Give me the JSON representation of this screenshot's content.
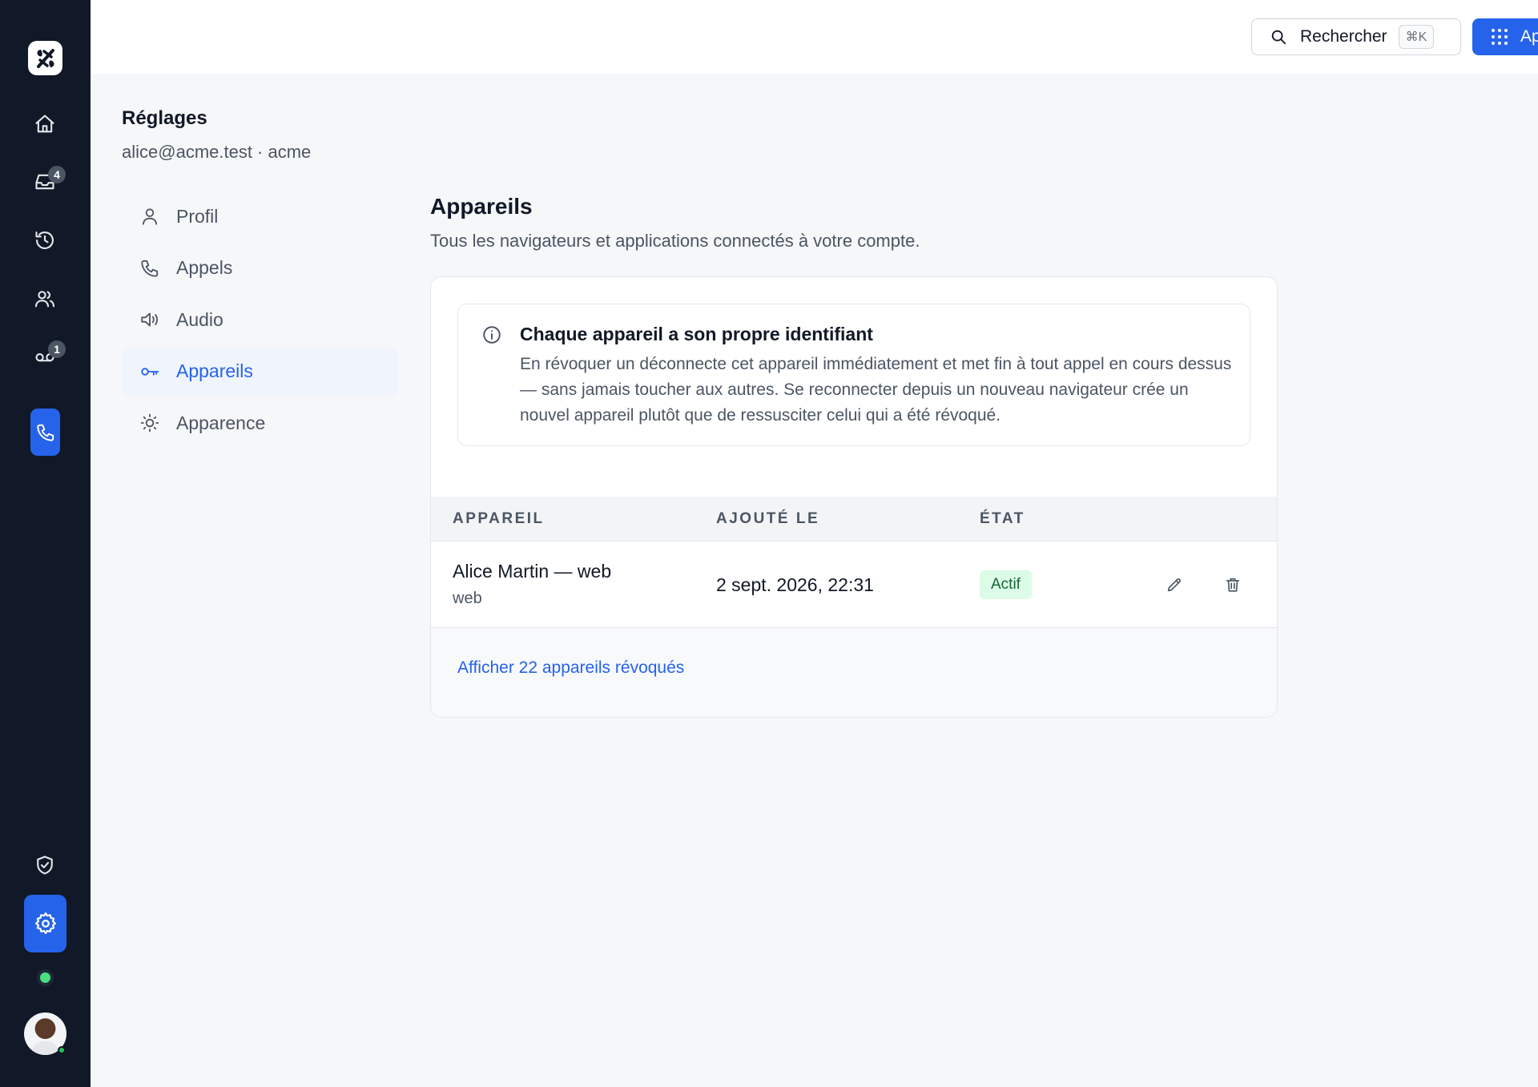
{
  "rail": {
    "logo_icon": "app-logo-icon",
    "items": [
      {
        "name": "home",
        "icon": "home-icon"
      },
      {
        "name": "inbox",
        "icon": "inbox-icon",
        "badge": "4"
      },
      {
        "name": "history",
        "icon": "history-icon"
      },
      {
        "name": "contacts",
        "icon": "users-icon"
      },
      {
        "name": "voicemail",
        "icon": "voicemail-icon",
        "badge": "1"
      }
    ],
    "call_icon": "phone-icon",
    "bottom": {
      "security_icon": "shield-check-icon",
      "settings_icon": "gear-icon",
      "presence_color": "#4ade80"
    }
  },
  "topbar": {
    "search_label": "Rechercher",
    "search_shortcut": "⌘K",
    "call_label": "Appeler"
  },
  "settings": {
    "title": "Réglages",
    "account": "alice@acme.test · acme",
    "nav": [
      {
        "label": "Profil",
        "icon": "user-icon",
        "active": false
      },
      {
        "label": "Appels",
        "icon": "phone-icon",
        "active": false
      },
      {
        "label": "Audio",
        "icon": "speaker-icon",
        "active": false
      },
      {
        "label": "Appareils",
        "icon": "key-icon",
        "active": true
      },
      {
        "label": "Apparence",
        "icon": "sun-icon",
        "active": false
      }
    ]
  },
  "devices": {
    "title": "Appareils",
    "subtitle": "Tous les navigateurs et applications connectés à votre compte.",
    "info": {
      "title": "Chaque appareil a son propre identifiant",
      "body": "En révoquer un déconnecte cet appareil immédiatement et met fin à tout appel en cours dessus — sans jamais toucher aux autres. Se reconnecter depuis un nouveau navigateur crée un nouvel appareil plutôt que de ressusciter celui qui a été révoqué."
    },
    "columns": [
      "APPAREIL",
      "AJOUTÉ LE",
      "ÉTAT"
    ],
    "rows": [
      {
        "name": "Alice Martin — web",
        "type": "web",
        "added": "2 sept. 2026, 22:31",
        "status": "Actif"
      }
    ],
    "revoked_link": "Afficher 22 appareils révoqués"
  },
  "colors": {
    "accent": "#2563eb",
    "rail_bg": "#111827",
    "status_active_bg": "#dcfce7",
    "status_active_text": "#166534"
  }
}
